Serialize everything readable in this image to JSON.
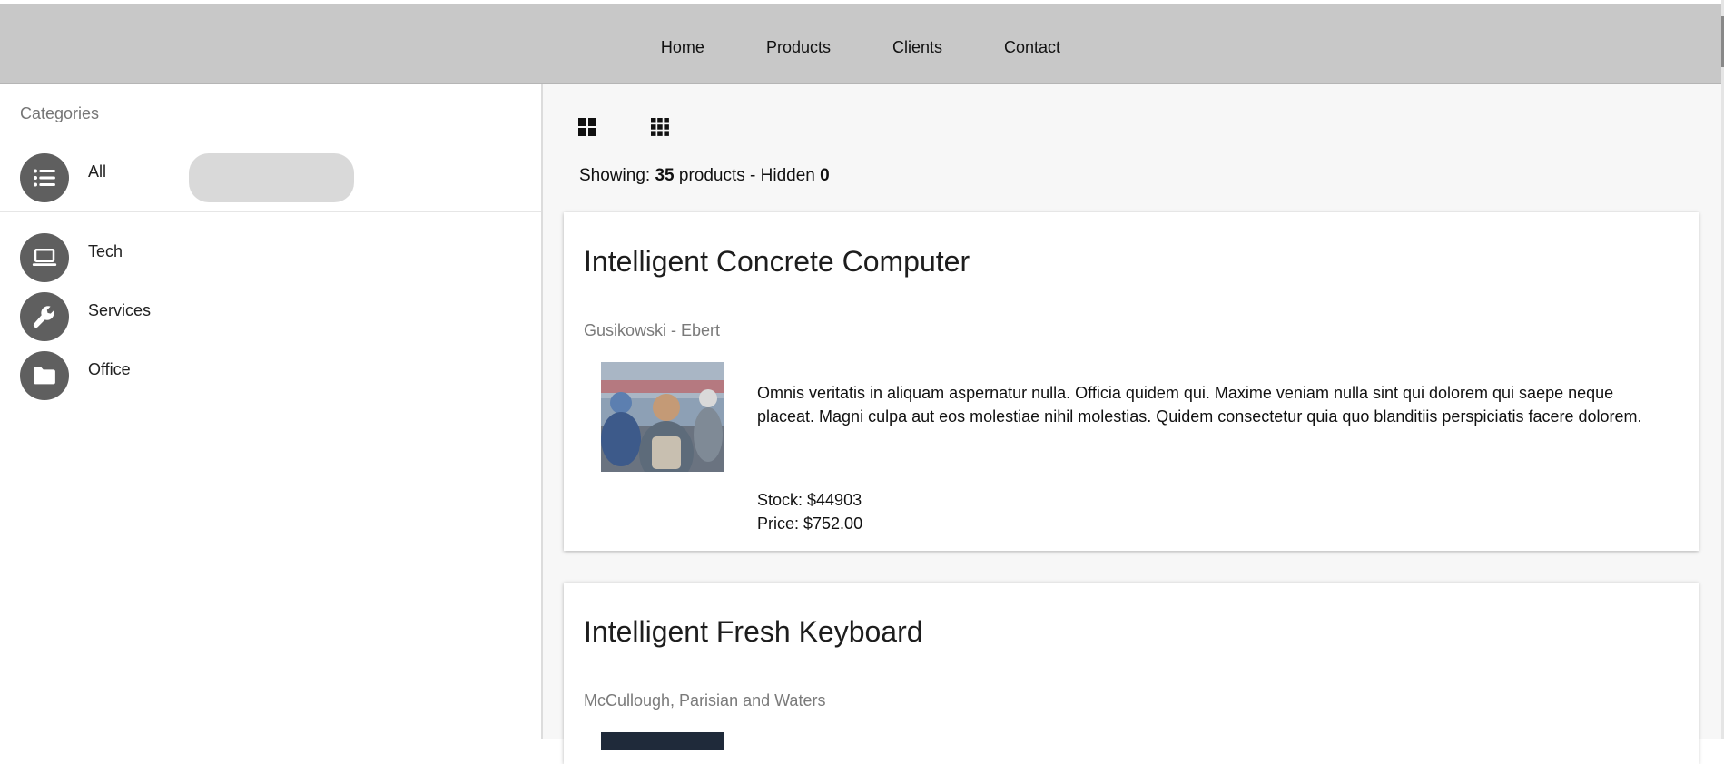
{
  "nav": {
    "items": [
      "Home",
      "Products",
      "Clients",
      "Contact"
    ]
  },
  "sidebar": {
    "title": "Categories",
    "items": [
      {
        "label": "All",
        "icon": "list-icon"
      },
      {
        "label": "Tech",
        "icon": "laptop-icon"
      },
      {
        "label": "Services",
        "icon": "wrench-icon"
      },
      {
        "label": "Office",
        "icon": "folder-icon"
      }
    ]
  },
  "main": {
    "showing_prefix": "Showing:",
    "showing_count": "35",
    "showing_mid": "products - Hidden",
    "hidden_count": "0",
    "view_icons": [
      "grid-large-icon",
      "grid-small-icon"
    ]
  },
  "products": [
    {
      "title": "Intelligent Concrete Computer",
      "company": "Gusikowski - Ebert",
      "description": "Omnis veritatis in aliquam aspernatur nulla. Officia quidem qui. Maxime veniam nulla sint qui dolorem qui saepe neque placeat. Magni culpa aut eos molestiae nihil molestias. Quidem consectetur quia quo blanditiis perspiciatis facere dolorem.",
      "stock": "Stock: $44903",
      "price": "Price: $752.00"
    },
    {
      "title": "Intelligent Fresh Keyboard",
      "company": "McCullough, Parisian and Waters"
    }
  ],
  "colors": {
    "topbar": "#c8c8c8",
    "avatar": "#5f5f5f",
    "main_bg": "#f7f7f7"
  }
}
